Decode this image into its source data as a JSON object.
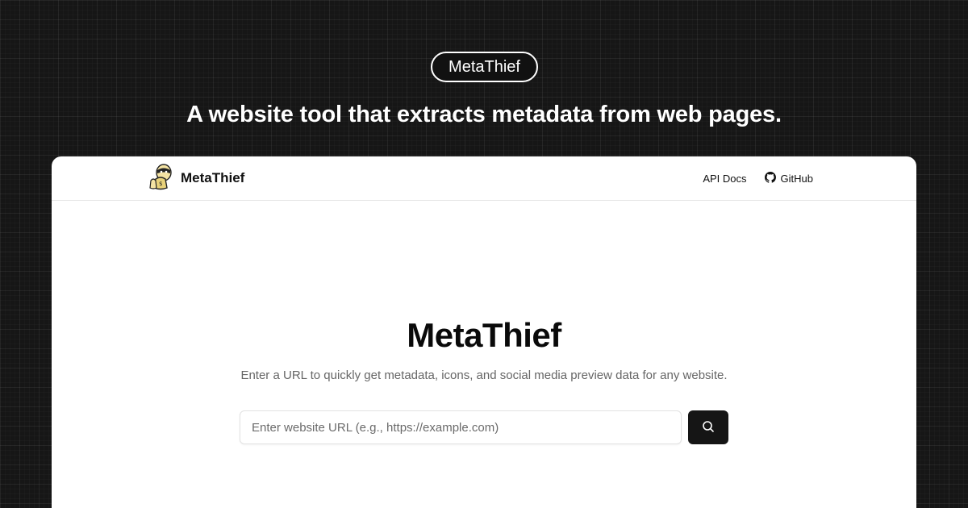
{
  "hero": {
    "badge": "MetaThief",
    "tagline": "A website tool that extracts metadata from web pages."
  },
  "navbar": {
    "brand": "MetaThief",
    "logo_icon": "thief-mascot-icon",
    "links": [
      {
        "label": "API Docs"
      },
      {
        "label": "GitHub",
        "icon": "github-icon"
      }
    ]
  },
  "main": {
    "title": "MetaThief",
    "subtitle": "Enter a URL to quickly get metadata, icons, and social media preview data for any website.",
    "search": {
      "value": "",
      "placeholder": "Enter website URL (e.g., https://example.com)",
      "button_icon": "search-icon"
    }
  },
  "colors": {
    "background": "#161616",
    "card": "#ffffff",
    "primary_button": "#151515",
    "muted_text": "#666666"
  }
}
